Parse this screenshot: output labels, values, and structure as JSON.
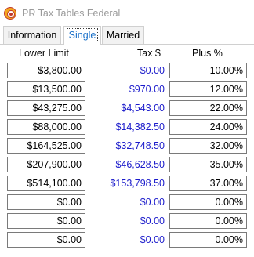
{
  "window": {
    "title": "PR Tax Tables Federal",
    "icon": "app-logo-icon"
  },
  "tabs": [
    {
      "label": "Information",
      "active": false
    },
    {
      "label": "Single",
      "active": true
    },
    {
      "label": "Married",
      "active": false
    }
  ],
  "columns": {
    "lower_limit": "Lower Limit",
    "tax": "Tax $",
    "plus": "Plus %"
  },
  "rows": [
    {
      "lower_limit": "$3,800.00",
      "tax": "$0.00",
      "plus": "10.00%"
    },
    {
      "lower_limit": "$13,500.00",
      "tax": "$970.00",
      "plus": "12.00%"
    },
    {
      "lower_limit": "$43,275.00",
      "tax": "$4,543.00",
      "plus": "22.00%"
    },
    {
      "lower_limit": "$88,000.00",
      "tax": "$14,382.50",
      "plus": "24.00%"
    },
    {
      "lower_limit": "$164,525.00",
      "tax": "$32,748.50",
      "plus": "32.00%"
    },
    {
      "lower_limit": "$207,900.00",
      "tax": "$46,628.50",
      "plus": "35.00%"
    },
    {
      "lower_limit": "$514,100.00",
      "tax": "$153,798.50",
      "plus": "37.00%"
    },
    {
      "lower_limit": "$0.00",
      "tax": "$0.00",
      "plus": "0.00%"
    },
    {
      "lower_limit": "$0.00",
      "tax": "$0.00",
      "plus": "0.00%"
    },
    {
      "lower_limit": "$0.00",
      "tax": "$0.00",
      "plus": "0.00%"
    }
  ],
  "colors": {
    "tax_text": "#1a1acb",
    "active_tab_text": "#1a70c9",
    "title_text": "#9a9a9a"
  }
}
